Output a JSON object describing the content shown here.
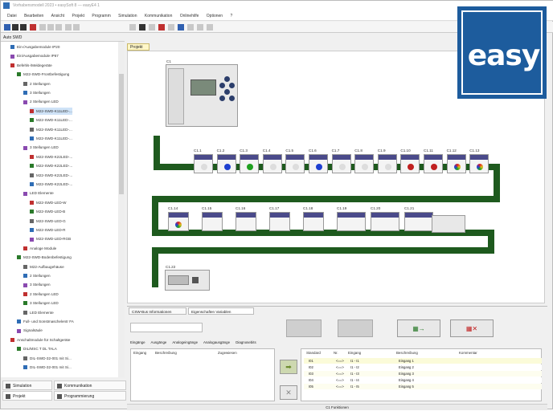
{
  "title": "Vorhabensmodell 2023 • easySoft 8 — easyE4 1",
  "menu": [
    "Datei",
    "Bearbeiten",
    "Ansicht",
    "Projekt",
    "Programm",
    "Simulation",
    "Kommunikation",
    "Onlinehilfe",
    "Optionen",
    "?"
  ],
  "sidebar": {
    "header": "Auto   SWD",
    "items": [
      {
        "label": "Ein-/Ausgabemodule IP20",
        "indent": 1
      },
      {
        "label": "Ein/Ausgabemodule IP67",
        "indent": 1
      },
      {
        "label": "Befehls-/Meldegeräte",
        "indent": 1
      },
      {
        "label": "M22-SWD-Frontbefestigung",
        "indent": 2
      },
      {
        "label": "2 Stellungen",
        "indent": 3
      },
      {
        "label": "3 Stellungen",
        "indent": 3
      },
      {
        "label": "2 Stellungen LED",
        "indent": 3
      },
      {
        "label": "M22-SWD-K11LED-...",
        "indent": 4,
        "selected": true
      },
      {
        "label": "M22-SWD-K11LED-...",
        "indent": 4
      },
      {
        "label": "M22-SWD-K11LED-...",
        "indent": 4
      },
      {
        "label": "M22-SWD-K11LED-...",
        "indent": 4
      },
      {
        "label": "3 Stellungen LED",
        "indent": 3
      },
      {
        "label": "M22-SWD-K22LED-...",
        "indent": 4
      },
      {
        "label": "M22-SWD-K22LED-...",
        "indent": 4
      },
      {
        "label": "M22-SWD-K22LED-...",
        "indent": 4
      },
      {
        "label": "M22-SWD-K22LED-...",
        "indent": 4
      },
      {
        "label": "LED Elemente",
        "indent": 3
      },
      {
        "label": "M22-SWD-LED-W",
        "indent": 4
      },
      {
        "label": "M22-SWD-LED-B",
        "indent": 4
      },
      {
        "label": "M22-SWD-LED-G",
        "indent": 4
      },
      {
        "label": "M22-SWD-LED-R",
        "indent": 4
      },
      {
        "label": "M22-SWD-LED-RGB",
        "indent": 4
      },
      {
        "label": "Analoge Module",
        "indent": 3
      },
      {
        "label": "M22-SWD-Bodenbefestigung",
        "indent": 2
      },
      {
        "label": "M22-Aufbaugehäuse",
        "indent": 3
      },
      {
        "label": "2 Stellungen",
        "indent": 3
      },
      {
        "label": "3 Stellungen",
        "indent": 3
      },
      {
        "label": "2 Stellungen LED",
        "indent": 3
      },
      {
        "label": "3 Stellungen LED",
        "indent": 3
      },
      {
        "label": "LED Elemente",
        "indent": 3
      },
      {
        "label": "Full- und Sonstmaschelentr FA",
        "indent": 2
      },
      {
        "label": "Signalsäule",
        "indent": 2
      },
      {
        "label": "Anschaltmodule für Schaltgeräte",
        "indent": 1
      },
      {
        "label": "DIL/MSC T DL TALA",
        "indent": 2
      },
      {
        "label": "DIL-SWD-32-001 mit Si...",
        "indent": 3
      },
      {
        "label": "DIL-SWD-32-001 mit Si...",
        "indent": 3
      }
    ]
  },
  "bottom_tabs": [
    "Simulation",
    "Kommunikation",
    "Projekt",
    "Programmierung"
  ],
  "canvas": {
    "tab": "Projekt",
    "controller_label": "C1",
    "row1_labels": [
      "C1.1",
      "C1.2",
      "C1.3",
      "C1.4",
      "C1.5",
      "C1.6",
      "C1.7",
      "C1.8",
      "C1.9",
      "C1.10",
      "C1.11",
      "C1.12",
      "C1.13"
    ],
    "row2_labels": [
      "C1.14",
      "C1.15",
      "C1.16",
      "C1.17",
      "C1.18",
      "C1.19",
      "C1.20",
      "C1.21"
    ],
    "row3_label": "C1.22"
  },
  "lower": {
    "tabs": [
      "CSW-Bus Informationen",
      "Eigenschaften Variablen"
    ],
    "subtabs": [
      "Eingänge",
      "Ausgänge",
      "Analogeingänge",
      "Analogausgänge",
      "Diagnosebits"
    ],
    "left_headers": [
      "Eingang",
      "Beschreibung",
      "Zugewiesen"
    ],
    "right_headers": [
      "Standard",
      "Nr.",
      "Eingang",
      "Beschreibung",
      "Kommentar"
    ],
    "rows": [
      {
        "std": "I01",
        "nr": "<==>",
        "in": "I1 - I1",
        "desc": "Eingang 1"
      },
      {
        "std": "I02",
        "nr": "<==>",
        "in": "I1 - I2",
        "desc": "Eingang 2"
      },
      {
        "std": "I03",
        "nr": "<==>",
        "in": "I1 - I3",
        "desc": "Eingang 3"
      },
      {
        "std": "I04",
        "nr": "<==>",
        "in": "I1 - I4",
        "desc": "Eingang 4"
      },
      {
        "std": "I05",
        "nr": "<==>",
        "in": "I1 - I5",
        "desc": "Eingang 5"
      }
    ],
    "status": "C1 Funktionen"
  },
  "logo": "easy",
  "colors": {
    "wire": "#1e5a1e",
    "logo_bg": "#1d5c9d",
    "row_highlight": "#fbfbd9"
  }
}
